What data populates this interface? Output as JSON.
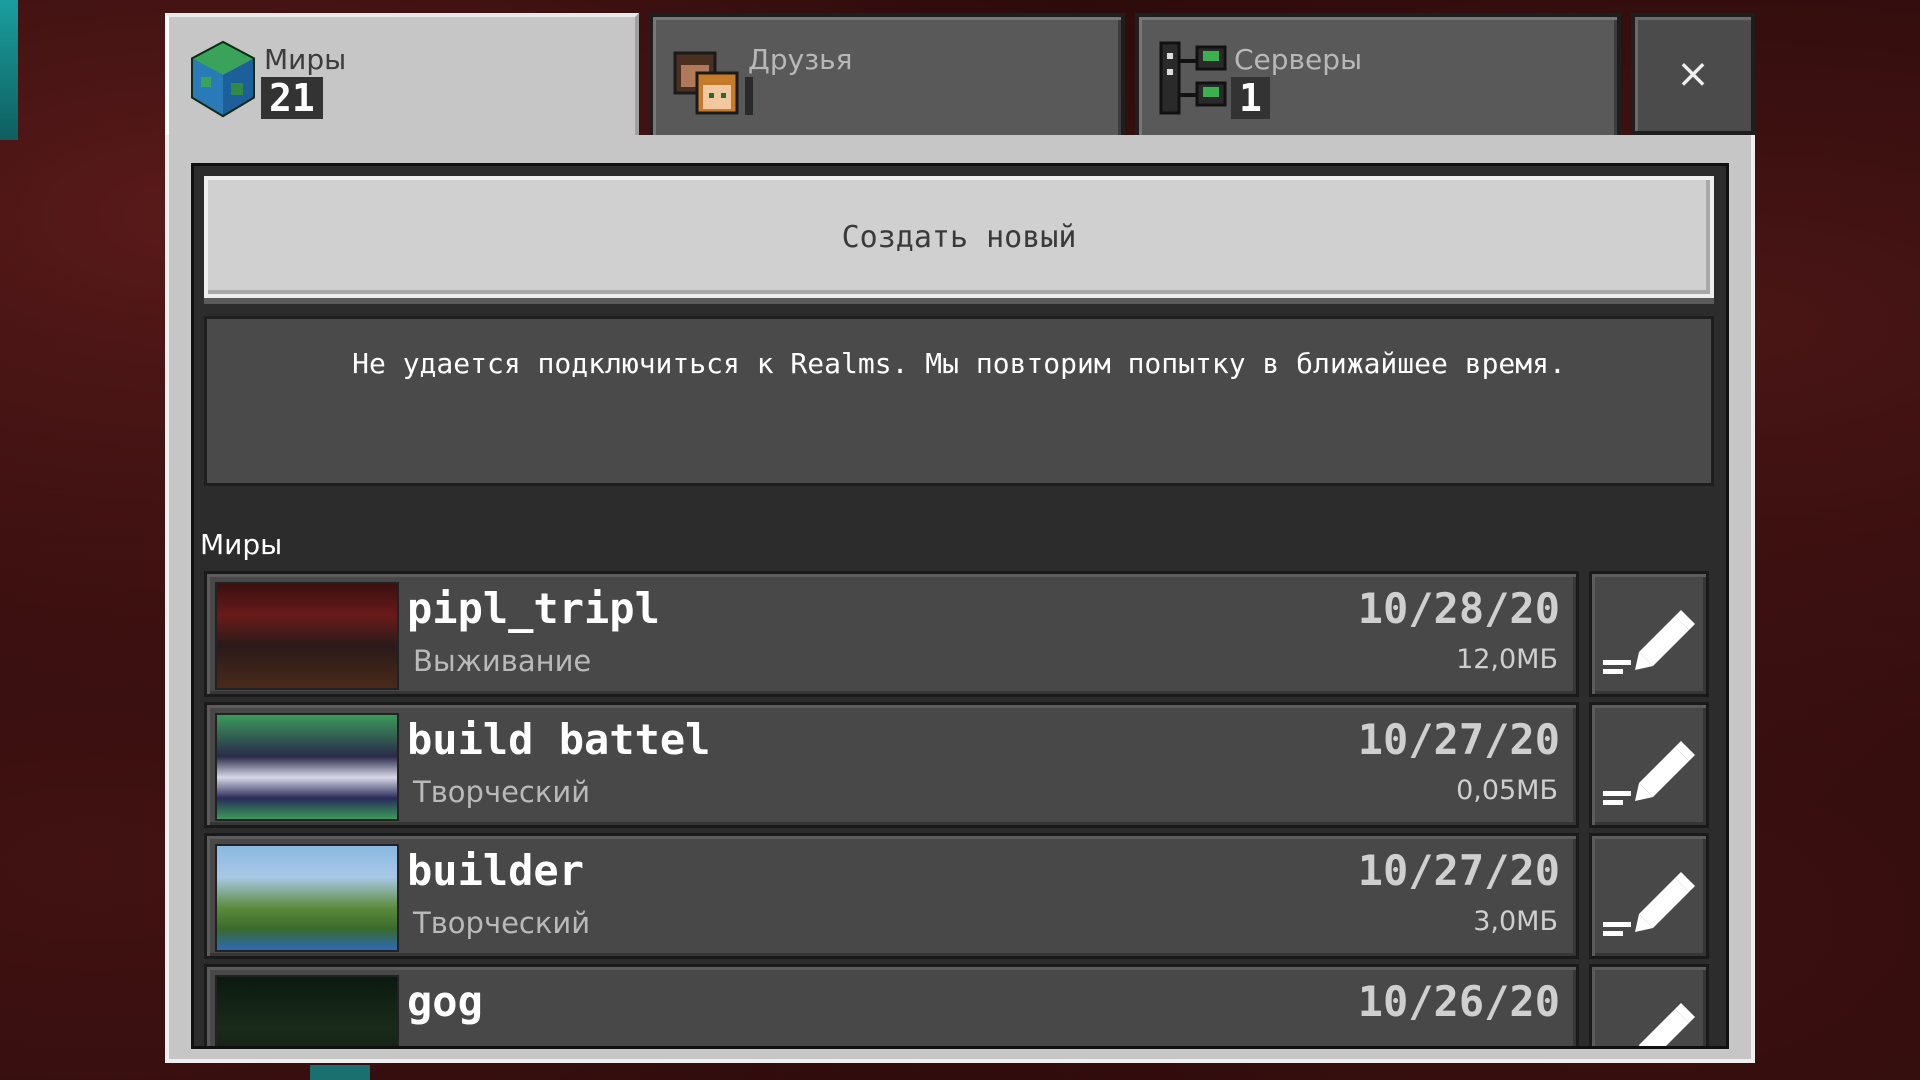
{
  "tabs": {
    "worlds": {
      "label": "Миры",
      "count": "21"
    },
    "friends": {
      "label": "Друзья",
      "count": ""
    },
    "servers": {
      "label": "Серверы",
      "count": "1"
    },
    "close_label": "×"
  },
  "create_button": "Создать новый",
  "notice": "Не удается подключиться к Realms. Мы повторим попытку в ближайшее время.",
  "section_label": "Миры",
  "worlds": [
    {
      "name": "pipl_tripl",
      "mode": "Выживание",
      "date": "10/28/20",
      "size": "12,0МБ"
    },
    {
      "name": "build battel",
      "mode": "Творческий",
      "date": "10/27/20",
      "size": "0,05МБ"
    },
    {
      "name": "builder",
      "mode": "Творческий",
      "date": "10/27/20",
      "size": "3,0МБ"
    },
    {
      "name": "gog",
      "mode": "",
      "date": "10/26/20",
      "size": ""
    }
  ],
  "colors": {
    "panel": "#c6c6c6",
    "inner": "#2c2c2c",
    "card": "#484848"
  }
}
